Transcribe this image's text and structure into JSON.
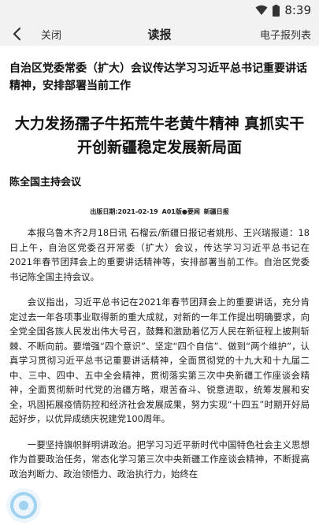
{
  "status_bar": {
    "time": "8:39"
  },
  "nav": {
    "close_label": "关闭",
    "title": "读报",
    "epaper_label": "电子报列表"
  },
  "article": {
    "subhead": "自治区党委常委（扩大）会议传达学习习近平总书记重要讲话精神，安排部署当前工作",
    "headline": "大力发扬孺子牛拓荒牛老黄牛精神 真抓实干开创新疆稳定发展新局面",
    "meeting_label": "陈全国主持会议",
    "pub_date": "出版日期:2021-02-19",
    "pub_section": "A01版●要闻",
    "pub_paper": "新疆日报",
    "paragraphs": [
      "本报乌鲁木齐2月18日讯 石榴云/新疆日报记者姚彤、王兴瑞报道：18日上午，自治区党委召开常委（扩大）会议，传达学习习近平总书记在2021年春节团拜会上的重要讲话精神等，安排部署当前工作。自治区党委书记陈全国主持会议。",
      "会议指出，习近平总书记在2021年春节团拜会上的重要讲话，充分肯定过去一年各项事业取得新的重大成就，对新的一年工作提出明确要求，向全党全国各族人民发出伟大号召，鼓舞和激励着亿万人民在新征程上披荆斩棘、不断向前。要增强“四个意识”、坚定“四个自信”、做到“两个维护”，认真学习贯彻习近平总书记重要讲话精神，全面贯彻党的十九大和十九届二中、三中、四中、五中全会精神，贯彻落实第三次中央新疆工作座谈会精神，全面贯彻新时代党的治疆方略，艰苦奋斗、锐意进取，统筹发展和安全，巩固拓展疫情防控和经济社会发展成果，努力实现“十四五”时期开好局起好步，以优异成绩庆祝建党100周年。",
      "一要坚持旗帜鲜明讲政治。把学习习近平新时代中国特色社会主义思想作为首要政治任务，常态化学习第三次中央新疆工作座谈会精神，不断提高政治判断力、政治领悟力、政治执行力，始终在"
    ]
  }
}
